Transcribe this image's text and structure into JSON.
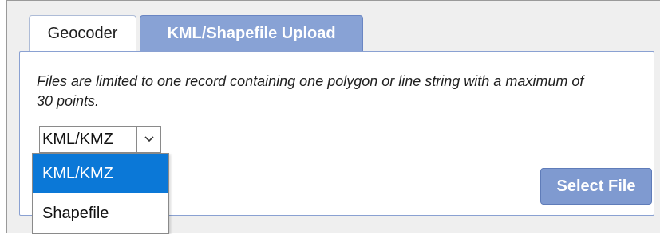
{
  "tabs": [
    {
      "label": "Geocoder",
      "active": false
    },
    {
      "label": "KML/Shapefile Upload",
      "active": true
    }
  ],
  "panel": {
    "note": "Files are limited to one record containing one polygon or line string with a maximum of 30 points."
  },
  "file_type_select": {
    "value": "KML/KMZ",
    "options": [
      "KML/KMZ",
      "Shapefile"
    ],
    "highlighted": "KML/KMZ"
  },
  "select_file_label": "Select File",
  "colors": {
    "active_tab": "#88a2d5",
    "button": "#7f9ad0",
    "option_highlight": "#0b78d7",
    "panel_border": "#8aa1d2"
  },
  "icons": {
    "dropdown": "chevron-down-icon"
  }
}
